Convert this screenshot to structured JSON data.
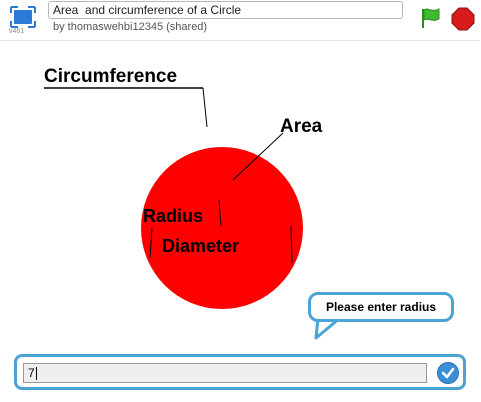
{
  "header": {
    "version": "v461",
    "title": "Area  and circumference of a Circle",
    "author": "by thomaswehbi12345 (shared)"
  },
  "stage": {
    "labels": {
      "circumference": "Circumference",
      "area": "Area",
      "radius": "Radius",
      "diameter": "Diameter"
    },
    "circle_color": "#ff0000",
    "speech_bubble": "Please enter radius"
  },
  "ask": {
    "value": "7"
  },
  "colors": {
    "accent": "#4ba4d6",
    "flag": "#3dbb2f",
    "stop": "#d81b1b"
  },
  "icons": [
    "fullscreen-icon",
    "green-flag-icon",
    "stop-icon",
    "checkmark-icon"
  ]
}
